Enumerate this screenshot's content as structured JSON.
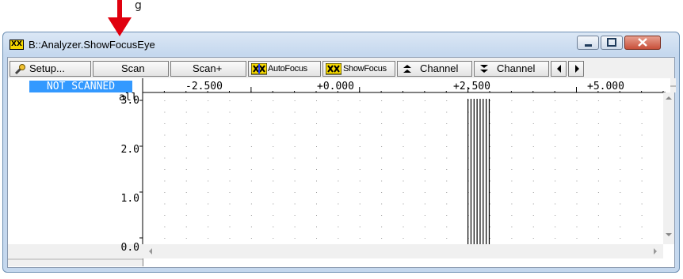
{
  "annotation": {
    "text": "g"
  },
  "window": {
    "title": "B::Analyzer.ShowFocusEye",
    "title_icon": "XX"
  },
  "toolbar": {
    "setup_label": "Setup...",
    "scan_label": "Scan",
    "scan_plus_label": "Scan+",
    "autofocus_label": "AutoFocus",
    "showfocus_label": "ShowFocus",
    "channel_up_label": "Channel",
    "channel_down_label": "Channel"
  },
  "status": {
    "badge": "NOT SCANNED",
    "channel_selector": "all"
  },
  "colors": {
    "badge": "#3399ff",
    "arrow": "#e0000e",
    "icon_yellow": "#f5d800"
  },
  "chart_data": {
    "type": "eye-diagram",
    "x_ticks": [
      "-2.500",
      "+0.000",
      "+2.500",
      "+5.000"
    ],
    "y_ticks": [
      "3.0",
      "2.0",
      "1.0",
      "0.0"
    ],
    "xlim": [
      -5.0,
      7.0
    ],
    "ylim": [
      0.0,
      3.0
    ],
    "grid": true,
    "vertical_lines_x": [
      2.5,
      2.57,
      2.64,
      2.71,
      2.78,
      2.85,
      2.92,
      2.99
    ]
  }
}
